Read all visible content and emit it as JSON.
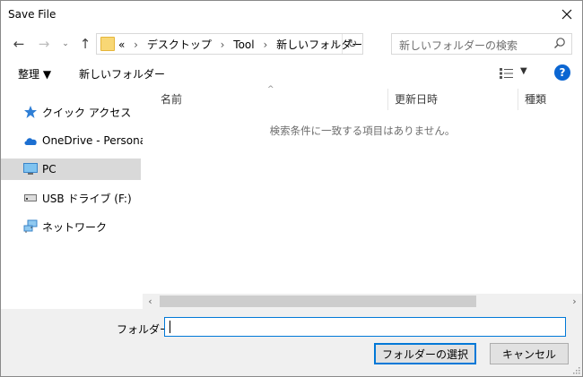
{
  "window": {
    "title": "Save File"
  },
  "address": {
    "overflow": "«",
    "crumbs": [
      "デスクトップ",
      "Tool",
      "新しいフォルダー"
    ]
  },
  "search": {
    "placeholder": "新しいフォルダーの検索"
  },
  "toolbar": {
    "organize_label": "整理 ▼",
    "new_folder_label": "新しいフォルダー"
  },
  "nav": {
    "items": [
      {
        "label": "クイック アクセス",
        "icon": "star-icon"
      },
      {
        "label": "OneDrive - Personal",
        "icon": "cloud-icon"
      },
      {
        "label": "PC",
        "icon": "pc-icon",
        "selected": true
      },
      {
        "label": "USB ドライブ (F:)",
        "icon": "usb-drive-icon"
      },
      {
        "label": "ネットワーク",
        "icon": "network-icon"
      }
    ]
  },
  "list": {
    "columns": [
      "名前",
      "更新日時",
      "種類"
    ],
    "empty_message": "検索条件に一致する項目はありません。"
  },
  "footer": {
    "folder_label": "フォルダー:",
    "folder_value": "",
    "select_button": "フォルダーの選択",
    "cancel_button": "キャンセル"
  },
  "colors": {
    "accent": "#0078d7",
    "selected": "#d9d9d9",
    "help": "#0b66d2",
    "folder": "#f8d775"
  }
}
